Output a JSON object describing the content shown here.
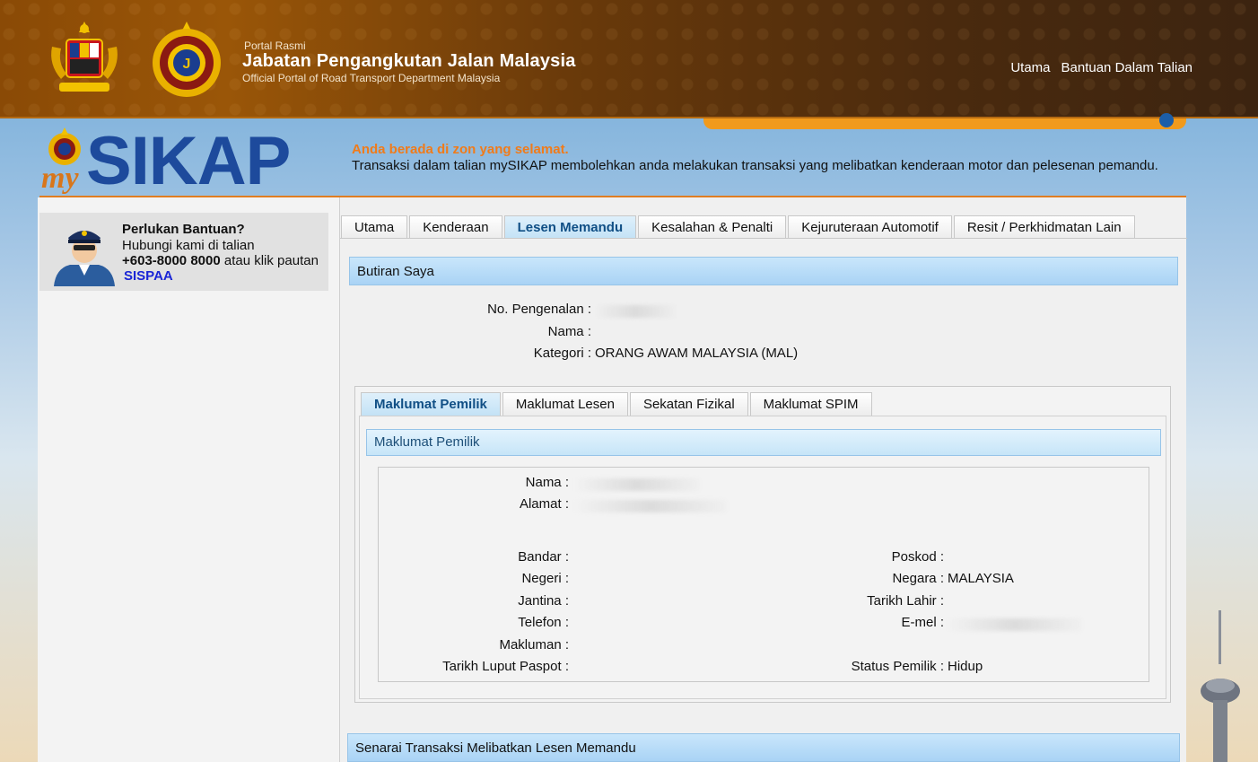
{
  "header": {
    "portal_small": "Portal Rasmi",
    "portal_title": "Jabatan Pengangkutan Jalan Malaysia",
    "portal_sub": "Official Portal of Road Transport Department Malaysia",
    "nav": [
      "Utama",
      "Bantuan Dalam Talian"
    ]
  },
  "brand": {
    "logo_my": "my",
    "logo_sikap": "SIKAP",
    "safe_zone": "Anda berada di zon yang selamat.",
    "intro": "Transaksi dalam talian mySIKAP membolehkan anda melakukan transaksi yang melibatkan kenderaan motor dan pelesenan pemandu."
  },
  "help": {
    "title": "Perlukan Bantuan?",
    "line1": "Hubungi kami di talian",
    "phone": "+603-8000 8000",
    "phone_suffix": " atau klik pautan",
    "link": "SISPAA"
  },
  "tabs": [
    "Utama",
    "Kenderaan",
    "Lesen Memandu",
    "Kesalahan & Penalti",
    "Kejuruteraan Automotif",
    "Resit / Perkhidmatan Lain"
  ],
  "active_tab": "Lesen Memandu",
  "butiran": {
    "heading": "Butiran Saya",
    "id_label": "No. Pengenalan :",
    "name_label": "Nama :",
    "category_label": "Kategori :",
    "category_value": "ORANG AWAM MALAYSIA (MAL)"
  },
  "subtabs": [
    "Maklumat Pemilik",
    "Maklumat Lesen",
    "Sekatan Fizikal",
    "Maklumat SPIM"
  ],
  "active_subtab": "Maklumat Pemilik",
  "pemilik": {
    "heading": "Maklumat Pemilik",
    "nama_label": "Nama :",
    "alamat_label": "Alamat :",
    "bandar_label": "Bandar :",
    "poskod_label": "Poskod :",
    "negeri_label": "Negeri :",
    "negara_label": "Negara :",
    "negara_value": "MALAYSIA",
    "jantina_label": "Jantina :",
    "tarikh_lahir_label": "Tarikh Lahir :",
    "telefon_label": "Telefon :",
    "emel_label": "E-mel :",
    "makluman_label": "Makluman :",
    "paspot_label": "Tarikh Luput Paspot :",
    "status_label": "Status Pemilik :",
    "status_value": "Hidup"
  },
  "senarai": {
    "heading": "Senarai Transaksi Melibatkan Lesen Memandu"
  },
  "colors": {
    "header_brown": "#6a3a0a",
    "accent_orange": "#f07b1a",
    "sikap_blue": "#1d4a9c",
    "bar_blue": "#a9d3f5",
    "link_blue": "#1a25d6"
  }
}
